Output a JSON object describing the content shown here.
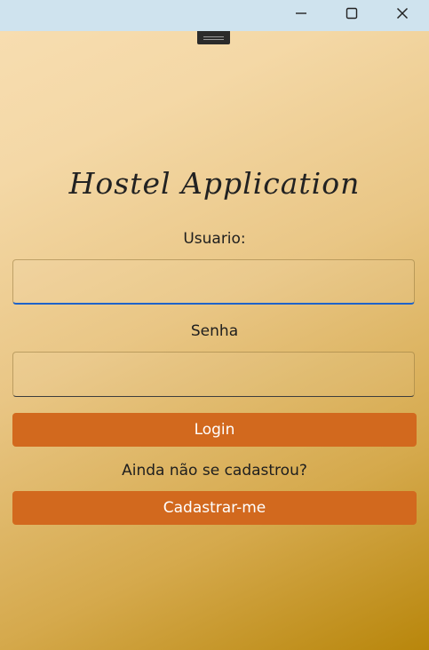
{
  "titlebar": {
    "minimize_icon": "minimize-icon",
    "maximize_icon": "maximize-icon",
    "close_icon": "close-icon"
  },
  "app": {
    "title": "Hostel Application",
    "username_label": "Usuario:",
    "username_value": "",
    "password_label": "Senha",
    "password_value": "",
    "login_button": "Login",
    "signup_prompt": "Ainda não se cadastrou?",
    "signup_button": "Cadastrar-me"
  },
  "colors": {
    "accent_button": "#d2691e",
    "focus_underline": "#1f63c9",
    "titlebar": "#cfe3ee"
  }
}
